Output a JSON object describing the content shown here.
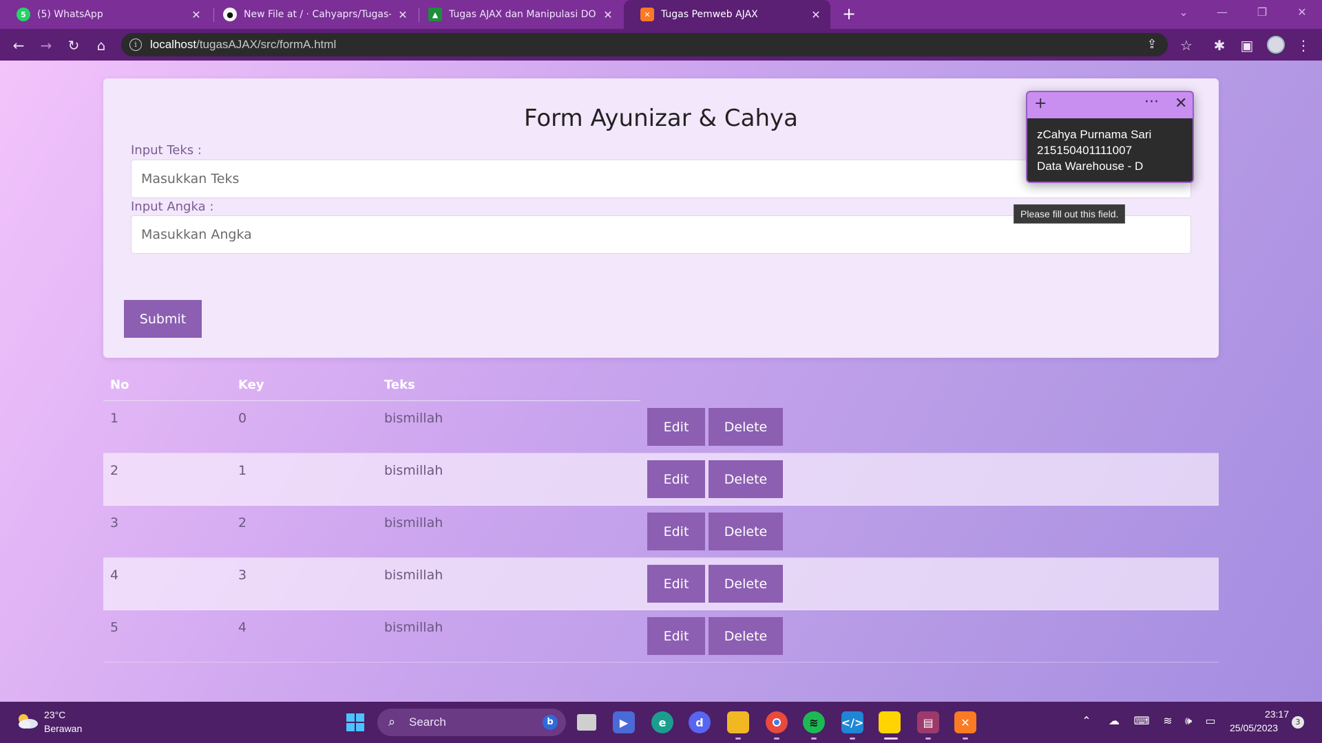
{
  "browser": {
    "tabs": [
      {
        "title": "(5) WhatsApp",
        "icon": "whatsapp-icon"
      },
      {
        "title": "New File at / · Cahyaprs/Tugas-P",
        "icon": "github-icon"
      },
      {
        "title": "Tugas AJAX dan Manipulasi DOM",
        "icon": "classroom-icon"
      },
      {
        "title": "Tugas Pemweb AJAX",
        "icon": "xampp-icon"
      }
    ],
    "active_tab": 3,
    "url_host": "localhost",
    "url_path": "/tugasAJAX/src/formA.html"
  },
  "form": {
    "title": "Form Ayunizar & Cahya",
    "text_label": "Input Teks :",
    "text_placeholder": "Masukkan Teks",
    "number_label": "Input Angka :",
    "number_placeholder": "Masukkan Angka",
    "submit_label": "Submit",
    "validation_tooltip": "Please fill out this field."
  },
  "table": {
    "headers": [
      "No",
      "Key",
      "Teks"
    ],
    "rows": [
      {
        "no": "1",
        "key": "0",
        "teks": "bismillah"
      },
      {
        "no": "2",
        "key": "1",
        "teks": "bismillah"
      },
      {
        "no": "3",
        "key": "2",
        "teks": "bismillah"
      },
      {
        "no": "4",
        "key": "3",
        "teks": "bismillah"
      },
      {
        "no": "5",
        "key": "4",
        "teks": "bismillah"
      }
    ],
    "edit_label": "Edit",
    "delete_label": "Delete"
  },
  "sticky_note": {
    "lines": [
      "zCahya Purnama Sari",
      "215150401111007",
      "Data Warehouse - D"
    ]
  },
  "taskbar": {
    "temperature": "23°C",
    "weather": "Berawan",
    "search_label": "Search",
    "time": "23:17",
    "date": "25/05/2023",
    "notifications": "3"
  },
  "colors": {
    "tab_bar": "#7b2f97",
    "toolbar": "#5b1f74",
    "button": "#8c5fb2",
    "card": "#f3e7fb",
    "note_header": "#c88ef0"
  }
}
